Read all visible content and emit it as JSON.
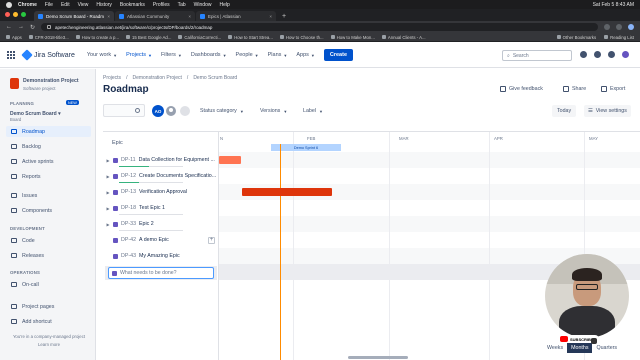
{
  "menubar": {
    "app": "Chrome",
    "items": [
      "File",
      "Edit",
      "View",
      "History",
      "Bookmarks",
      "Profiles",
      "Tab",
      "Window",
      "Help"
    ],
    "clock": "Sat Feb 5  8:43 AM"
  },
  "tabs": [
    {
      "label": "Demo Scrum Board - Roadm",
      "active": true,
      "color": "#2684ff"
    },
    {
      "label": "Atlassian Community",
      "active": false,
      "color": "#2684ff"
    },
    {
      "label": "Epics | Atlassian",
      "active": false,
      "color": "#2684ff"
    }
  ],
  "address": {
    "url": "apetechengineering.atlassian.net/jira/software/c/projects/DP/boards/2/roadmap"
  },
  "bookmarks": {
    "items": [
      "Apps",
      "CFR-2018-title3...",
      "How to create a p...",
      "15 Best Google Ad...",
      "CaliforniaCorrecti...",
      "How to Start Strea...",
      "How to Choose th...",
      "How to Make Mon...",
      "Annual Clients - A..."
    ],
    "other": "Other Bookmarks",
    "reading": "Reading List"
  },
  "jira_nav": {
    "product": "Jira Software",
    "items": [
      "Your work",
      "Projects",
      "Filters",
      "Dashboards",
      "People",
      "Plans",
      "Apps"
    ],
    "create": "Create",
    "search_placeholder": "Search"
  },
  "sidebar": {
    "project_name": "Demonstration Project",
    "project_type": "Software project",
    "planning_label": "PLANNING",
    "new_badge": "NEW",
    "board_name": "Demo Scrum Board",
    "board_sub": "Board",
    "planning_items": [
      "Roadmap",
      "Backlog",
      "Active sprints",
      "Reports"
    ],
    "other_items": [
      "Issues",
      "Components"
    ],
    "development_label": "DEVELOPMENT",
    "development_items": [
      "Code",
      "Releases"
    ],
    "operations_label": "OPERATIONS",
    "operations_items": [
      "On-call"
    ],
    "footer_items": [
      "Project pages",
      "Add shortcut"
    ],
    "footer_note": "You're in a company-managed project",
    "learn_more": "Learn more"
  },
  "page": {
    "breadcrumbs": [
      "Projects",
      "Demonstration Project",
      "Demo Scrum Board"
    ],
    "title": "Roadmap",
    "give_feedback": "Give feedback",
    "share": "Share",
    "export": "Export"
  },
  "filters": {
    "avatar_initials": "AO",
    "status_category": "Status category",
    "versions": "Versions",
    "label": "Label",
    "today": "Today",
    "view_settings": "View settings"
  },
  "roadmap": {
    "epic_header": "Epic",
    "months": [
      "FEB",
      "MAR",
      "APR",
      "MAY"
    ],
    "sprint": "Demo Sprint 6",
    "rows": [
      {
        "key": "DP-11",
        "summary": "Data Collection for Equipment ...",
        "progress": 0.5,
        "bar_color": "#ff7452"
      },
      {
        "key": "DP-12",
        "summary": "Create Documents Specificatio...",
        "progress": 0.3,
        "bar_color": ""
      },
      {
        "key": "DP-13",
        "summary": "Verification Approval",
        "progress": 0.0,
        "bar_color": "#de350b"
      },
      {
        "key": "DP-18",
        "summary": "Test Epic 1",
        "progress": 0.0,
        "bar_color": ""
      },
      {
        "key": "DP-33",
        "summary": "Epic 2",
        "progress": 0.0,
        "bar_color": ""
      },
      {
        "key": "DP-42",
        "summary": "A demo Epic",
        "progress": 0.0,
        "bar_color": ""
      },
      {
        "key": "DP-43",
        "summary": "My Amazing Epic",
        "progress": 0.0,
        "bar_color": ""
      }
    ],
    "create_placeholder": "What needs to be done?",
    "view_options": [
      "Weeks",
      "Months",
      "Quarters"
    ],
    "selected_view": "Months"
  },
  "overlay": {
    "subscribe": "SUBSCRIBED"
  }
}
